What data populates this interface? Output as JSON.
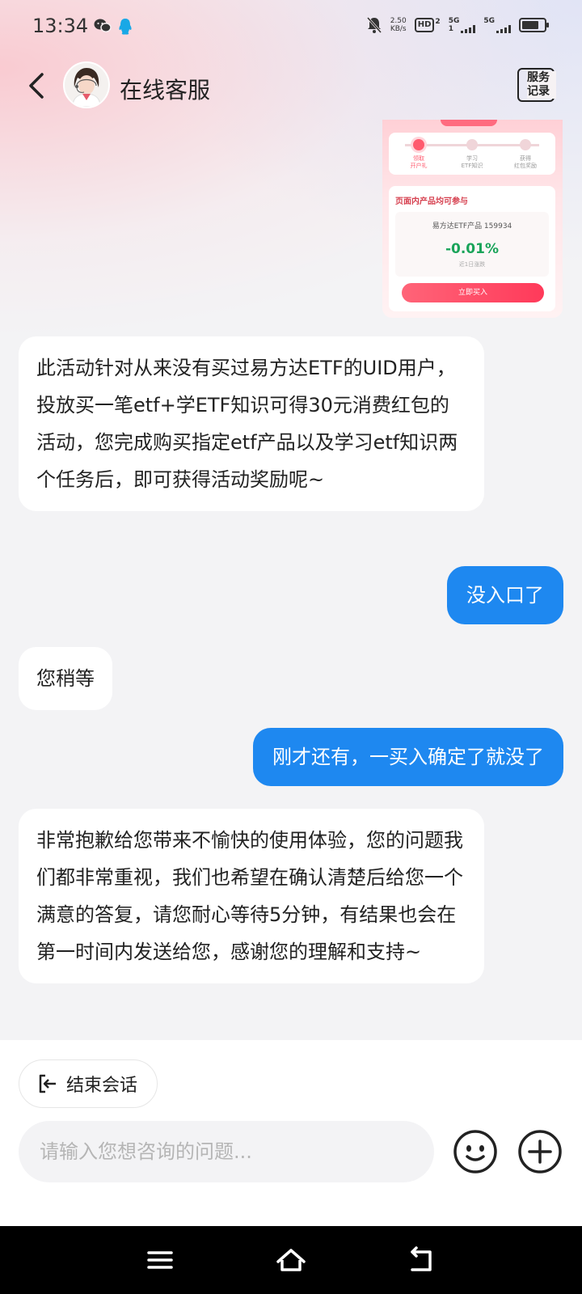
{
  "status_bar": {
    "time": "13:34",
    "net_speed_value": "2.50",
    "net_speed_unit": "KB/s",
    "hd_label": "HD",
    "hd_sim": "2",
    "sim1_network": "5G",
    "sim1_index": "1",
    "sim2_network": "5G"
  },
  "header": {
    "title": "在线客服",
    "service_record_label": "服务\n记录"
  },
  "messages": [
    {
      "side": "left",
      "text": "此活动针对从来没有买过易方达ETF的UID用户，投放买一笔etf+学ETF知识可得30元消费红包的活动，您完成购买指定etf产品以及学习etf知识两个任务后，即可获得活动奖励呢~"
    },
    {
      "side": "right",
      "text": "没入口了"
    },
    {
      "side": "left",
      "text": "您稍等"
    },
    {
      "side": "right",
      "text": "刚才还有，一买入确定了就没了"
    },
    {
      "side": "left",
      "text": "非常抱歉给您带来不愉快的使用体验，您的问题我们都非常重视，我们也希望在确认清楚后给您一个满意的答复，请您耐心等待5分钟，有结果也会在第一时间内发送给您，感谢您的理解和支持~"
    }
  ],
  "image_card": {
    "step1": "领取\n开户礼",
    "step2": "学习\nETF知识",
    "step3": "获得\n红包奖励",
    "panel_title": "页面内产品均可参与",
    "product_name": "易方达ETF产品 159934",
    "product_pct": "-0.01%",
    "product_sub": "近1日涨跌",
    "buy_label": "立即买入"
  },
  "bottom": {
    "end_session_label": "结束会话",
    "input_placeholder": "请输入您想咨询的问题...",
    "input_value": ""
  },
  "colors": {
    "accent_blue": "#1e88f0",
    "background": "#f3f3f5"
  }
}
